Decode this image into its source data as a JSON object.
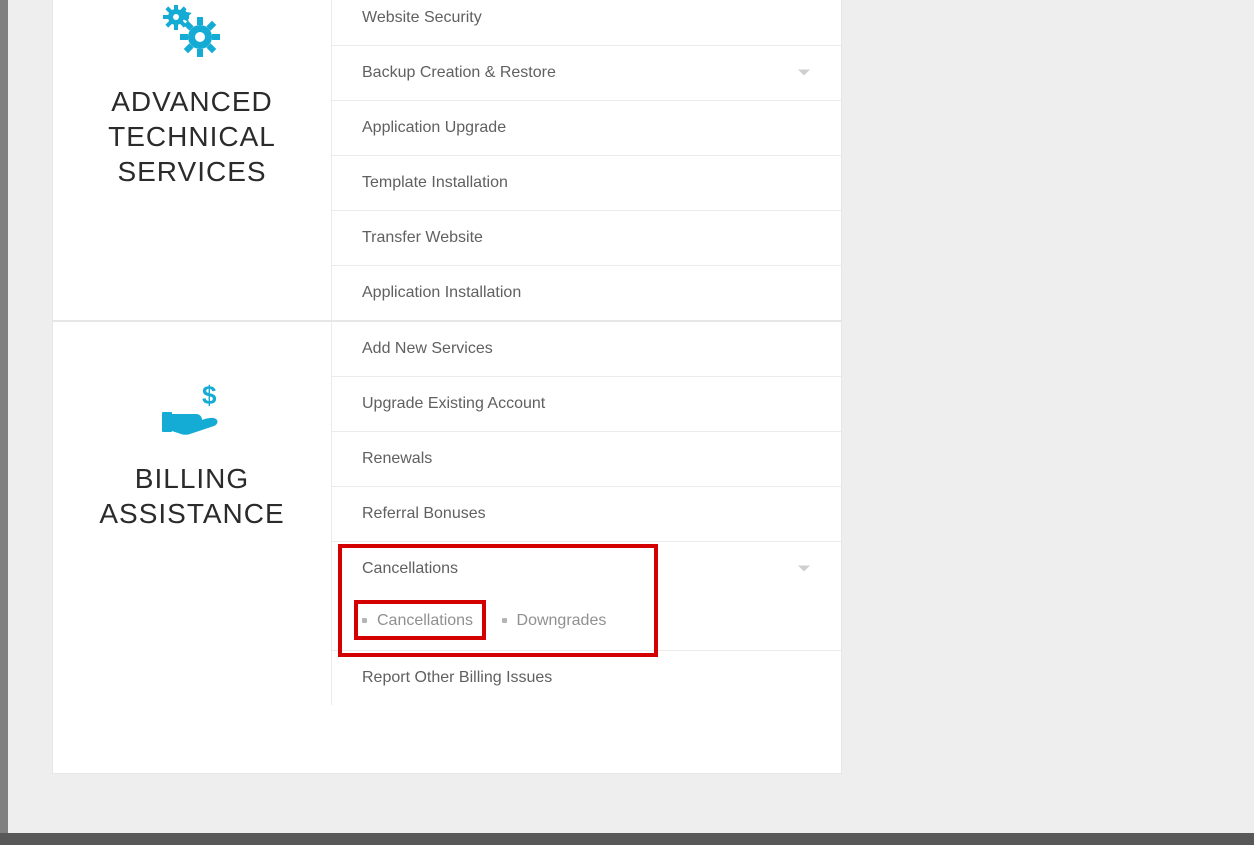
{
  "sections": [
    {
      "id": "advanced",
      "titleLine1": "Advanced",
      "titleLine2": "Technical Services",
      "icon": "gears-icon",
      "items": [
        {
          "label": "Website Security",
          "hasDropdown": false
        },
        {
          "label": "Backup Creation & Restore",
          "hasDropdown": true
        },
        {
          "label": "Application Upgrade",
          "hasDropdown": false
        },
        {
          "label": "Template Installation",
          "hasDropdown": false
        },
        {
          "label": "Transfer Website",
          "hasDropdown": false
        },
        {
          "label": "Application Installation",
          "hasDropdown": false
        }
      ]
    },
    {
      "id": "billing",
      "titleLine1": "Billing Assistance",
      "titleLine2": "",
      "icon": "hand-dollar-icon",
      "items": [
        {
          "label": "Add New Services",
          "hasDropdown": false
        },
        {
          "label": "Upgrade Existing Account",
          "hasDropdown": false
        },
        {
          "label": "Renewals",
          "hasDropdown": false
        },
        {
          "label": "Referral Bonuses",
          "hasDropdown": false
        },
        {
          "label": "Cancellations",
          "hasDropdown": true,
          "expanded": true,
          "subitems": [
            {
              "label": "Cancellations"
            },
            {
              "label": "Downgrades"
            }
          ]
        },
        {
          "label": "Report Other Billing Issues",
          "hasDropdown": false
        }
      ]
    }
  ],
  "colors": {
    "accent": "#14abd4",
    "highlight": "#d40000"
  }
}
